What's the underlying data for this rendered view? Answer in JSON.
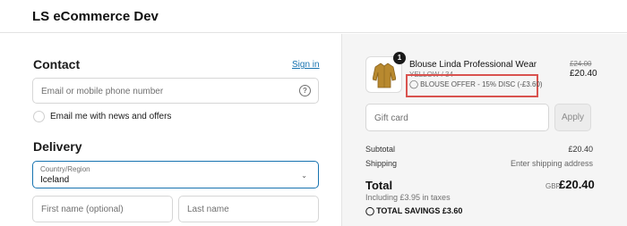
{
  "header": {
    "store_name": "LS eCommerce Dev"
  },
  "contact": {
    "heading": "Contact",
    "signin_label": "Sign in",
    "email_placeholder": "Email or mobile phone number",
    "newsletter_label": "Email me with news and offers"
  },
  "delivery": {
    "heading": "Delivery",
    "country_label": "Country/Region",
    "country_value": "Iceland",
    "first_name_placeholder": "First name (optional)",
    "last_name_placeholder": "Last name"
  },
  "order": {
    "quantity": "1",
    "product_name": "Blouse Linda Professional Wear",
    "variant": "YELLOW / 34",
    "discount_text": "BLOUSE OFFER - 15% DISC (-£3.60)",
    "original_price": "£24.00",
    "price": "£20.40",
    "gift_card_placeholder": "Gift card",
    "apply_label": "Apply",
    "subtotal_label": "Subtotal",
    "subtotal_value": "£20.40",
    "shipping_label": "Shipping",
    "shipping_value": "Enter shipping address",
    "total_label": "Total",
    "currency": "GBP",
    "total_value": "£20.40",
    "taxes_text": "Including £3.95 in taxes",
    "savings_text": "TOTAL SAVINGS  £3.60"
  },
  "icons": {
    "help": "help-circle-icon",
    "tag": "tag-icon",
    "chevron": "chevron-down-icon"
  },
  "colors": {
    "link": "#1773b0",
    "focus_border": "#1773b0",
    "highlight_box": "#d9534f",
    "summary_bg": "#f5f5f5"
  }
}
